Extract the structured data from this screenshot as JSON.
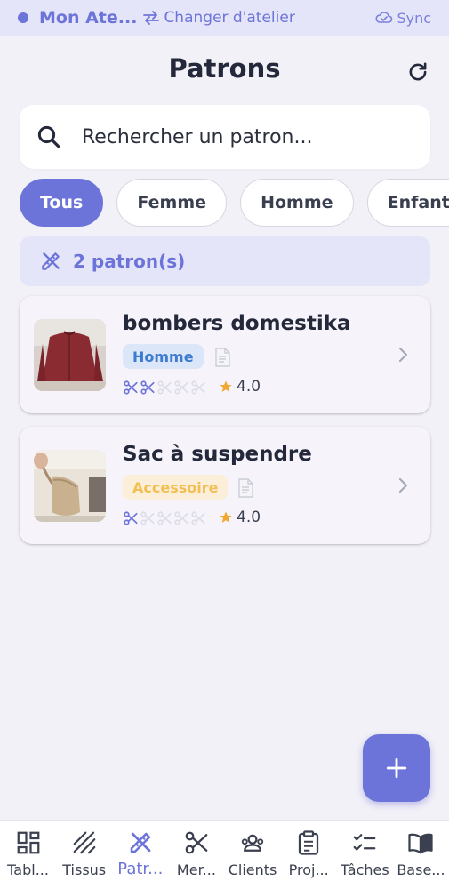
{
  "topbar": {
    "workspace_name": "Mon Ate...",
    "switch_label": "Changer d'atelier",
    "sync_label": "Sync"
  },
  "header": {
    "title": "Patrons"
  },
  "search": {
    "placeholder": "Rechercher un patron..."
  },
  "filters": [
    "Tous",
    "Femme",
    "Homme",
    "Enfant"
  ],
  "count_label": "2 patron(s)",
  "patterns": [
    {
      "name": "bombers domestika",
      "category": "Homme",
      "difficulty": 2,
      "difficulty_max": 5,
      "rating": "4.0"
    },
    {
      "name": "Sac à suspendre",
      "category": "Accessoire",
      "difficulty": 1,
      "difficulty_max": 5,
      "rating": "4.0"
    }
  ],
  "nav": [
    {
      "label": "Tabl...",
      "icon": "dashboard-icon"
    },
    {
      "label": "Tissus",
      "icon": "fabric-icon"
    },
    {
      "label": "Patr...",
      "icon": "pattern-icon",
      "active": true
    },
    {
      "label": "Mer...",
      "icon": "scissors-icon"
    },
    {
      "label": "Clients",
      "icon": "people-icon"
    },
    {
      "label": "Proj...",
      "icon": "clipboard-icon"
    },
    {
      "label": "Tâches",
      "icon": "checklist-icon"
    },
    {
      "label": "Base...",
      "icon": "book-icon"
    }
  ],
  "colors": {
    "accent": "#6d74d9",
    "accent_soft": "#e4e5f8",
    "badge_homme_bg": "#dbe6f8",
    "badge_homme_text": "#3d7bd0",
    "badge_accessoire_bg": "#fcefd9",
    "badge_accessoire_text": "#f3bf55",
    "star": "#f0a833",
    "background": "#f2f1f7"
  }
}
